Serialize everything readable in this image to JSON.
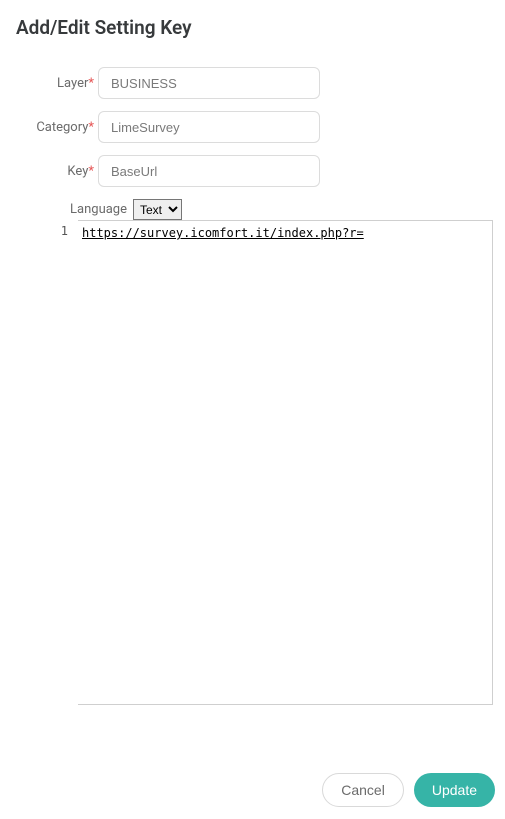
{
  "title": "Add/Edit Setting Key",
  "labels": {
    "layer": "Layer",
    "category": "Category",
    "key": "Key",
    "language": "Language"
  },
  "fields": {
    "layer": "BUSINESS",
    "category": "LimeSurvey",
    "key": "BaseUrl",
    "language_selected": "Text"
  },
  "editor": {
    "line_number": "1",
    "content": "https://survey.icomfort.it/index.php?r="
  },
  "buttons": {
    "cancel": "Cancel",
    "update": "Update"
  }
}
